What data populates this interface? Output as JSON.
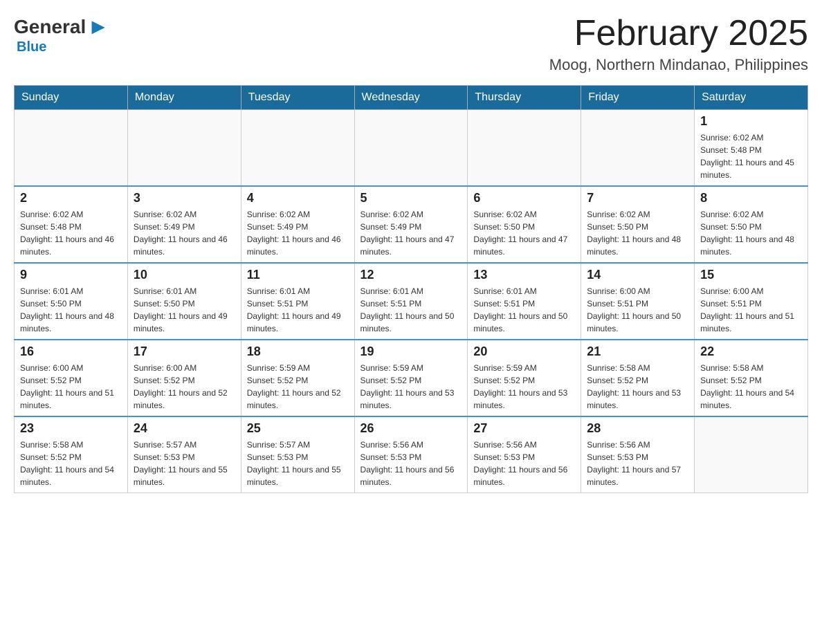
{
  "header": {
    "logo_general": "General",
    "logo_blue": "Blue",
    "month_title": "February 2025",
    "location": "Moog, Northern Mindanao, Philippines"
  },
  "days_of_week": [
    "Sunday",
    "Monday",
    "Tuesday",
    "Wednesday",
    "Thursday",
    "Friday",
    "Saturday"
  ],
  "weeks": [
    {
      "days": [
        {
          "number": "",
          "info": ""
        },
        {
          "number": "",
          "info": ""
        },
        {
          "number": "",
          "info": ""
        },
        {
          "number": "",
          "info": ""
        },
        {
          "number": "",
          "info": ""
        },
        {
          "number": "",
          "info": ""
        },
        {
          "number": "1",
          "info": "Sunrise: 6:02 AM\nSunset: 5:48 PM\nDaylight: 11 hours and 45 minutes."
        }
      ]
    },
    {
      "days": [
        {
          "number": "2",
          "info": "Sunrise: 6:02 AM\nSunset: 5:48 PM\nDaylight: 11 hours and 46 minutes."
        },
        {
          "number": "3",
          "info": "Sunrise: 6:02 AM\nSunset: 5:49 PM\nDaylight: 11 hours and 46 minutes."
        },
        {
          "number": "4",
          "info": "Sunrise: 6:02 AM\nSunset: 5:49 PM\nDaylight: 11 hours and 46 minutes."
        },
        {
          "number": "5",
          "info": "Sunrise: 6:02 AM\nSunset: 5:49 PM\nDaylight: 11 hours and 47 minutes."
        },
        {
          "number": "6",
          "info": "Sunrise: 6:02 AM\nSunset: 5:50 PM\nDaylight: 11 hours and 47 minutes."
        },
        {
          "number": "7",
          "info": "Sunrise: 6:02 AM\nSunset: 5:50 PM\nDaylight: 11 hours and 48 minutes."
        },
        {
          "number": "8",
          "info": "Sunrise: 6:02 AM\nSunset: 5:50 PM\nDaylight: 11 hours and 48 minutes."
        }
      ]
    },
    {
      "days": [
        {
          "number": "9",
          "info": "Sunrise: 6:01 AM\nSunset: 5:50 PM\nDaylight: 11 hours and 48 minutes."
        },
        {
          "number": "10",
          "info": "Sunrise: 6:01 AM\nSunset: 5:50 PM\nDaylight: 11 hours and 49 minutes."
        },
        {
          "number": "11",
          "info": "Sunrise: 6:01 AM\nSunset: 5:51 PM\nDaylight: 11 hours and 49 minutes."
        },
        {
          "number": "12",
          "info": "Sunrise: 6:01 AM\nSunset: 5:51 PM\nDaylight: 11 hours and 50 minutes."
        },
        {
          "number": "13",
          "info": "Sunrise: 6:01 AM\nSunset: 5:51 PM\nDaylight: 11 hours and 50 minutes."
        },
        {
          "number": "14",
          "info": "Sunrise: 6:00 AM\nSunset: 5:51 PM\nDaylight: 11 hours and 50 minutes."
        },
        {
          "number": "15",
          "info": "Sunrise: 6:00 AM\nSunset: 5:51 PM\nDaylight: 11 hours and 51 minutes."
        }
      ]
    },
    {
      "days": [
        {
          "number": "16",
          "info": "Sunrise: 6:00 AM\nSunset: 5:52 PM\nDaylight: 11 hours and 51 minutes."
        },
        {
          "number": "17",
          "info": "Sunrise: 6:00 AM\nSunset: 5:52 PM\nDaylight: 11 hours and 52 minutes."
        },
        {
          "number": "18",
          "info": "Sunrise: 5:59 AM\nSunset: 5:52 PM\nDaylight: 11 hours and 52 minutes."
        },
        {
          "number": "19",
          "info": "Sunrise: 5:59 AM\nSunset: 5:52 PM\nDaylight: 11 hours and 53 minutes."
        },
        {
          "number": "20",
          "info": "Sunrise: 5:59 AM\nSunset: 5:52 PM\nDaylight: 11 hours and 53 minutes."
        },
        {
          "number": "21",
          "info": "Sunrise: 5:58 AM\nSunset: 5:52 PM\nDaylight: 11 hours and 53 minutes."
        },
        {
          "number": "22",
          "info": "Sunrise: 5:58 AM\nSunset: 5:52 PM\nDaylight: 11 hours and 54 minutes."
        }
      ]
    },
    {
      "days": [
        {
          "number": "23",
          "info": "Sunrise: 5:58 AM\nSunset: 5:52 PM\nDaylight: 11 hours and 54 minutes."
        },
        {
          "number": "24",
          "info": "Sunrise: 5:57 AM\nSunset: 5:53 PM\nDaylight: 11 hours and 55 minutes."
        },
        {
          "number": "25",
          "info": "Sunrise: 5:57 AM\nSunset: 5:53 PM\nDaylight: 11 hours and 55 minutes."
        },
        {
          "number": "26",
          "info": "Sunrise: 5:56 AM\nSunset: 5:53 PM\nDaylight: 11 hours and 56 minutes."
        },
        {
          "number": "27",
          "info": "Sunrise: 5:56 AM\nSunset: 5:53 PM\nDaylight: 11 hours and 56 minutes."
        },
        {
          "number": "28",
          "info": "Sunrise: 5:56 AM\nSunset: 5:53 PM\nDaylight: 11 hours and 57 minutes."
        },
        {
          "number": "",
          "info": ""
        }
      ]
    }
  ]
}
